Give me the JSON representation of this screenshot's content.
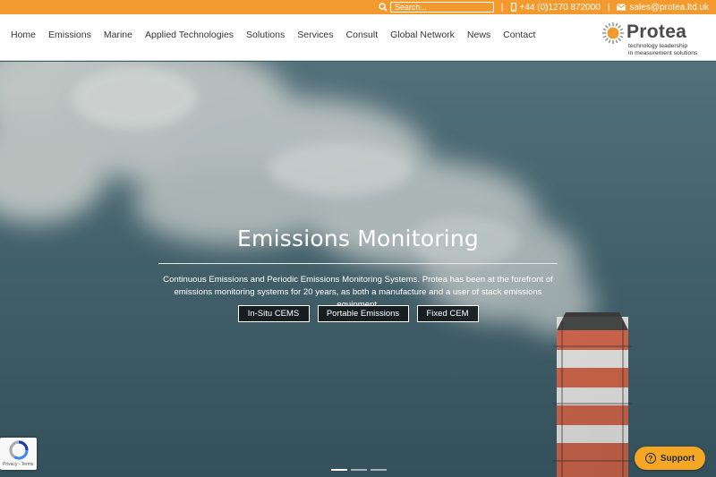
{
  "topbar": {
    "search_placeholder": "Search...",
    "separator": "|",
    "phone": "+44 (0)1270 872000",
    "email": "sales@protea.ltd.uk"
  },
  "nav": {
    "items": [
      "Home",
      "Emissions",
      "Marine",
      "Applied Technologies",
      "Solutions",
      "Services",
      "Consult",
      "Global Network",
      "News",
      "Contact"
    ]
  },
  "logo": {
    "name": "Protea",
    "tagline_1": "technology leadership",
    "tagline_2": "in measurement solutions"
  },
  "hero": {
    "title": "Emissions Monitoring",
    "description": "Continuous Emissions and Periodic Emissions Monitoring Systems. Protea has been at the forefront of emissions monitoring systems for 20 years, as both a manufacture and a user of stack emissions equipment.",
    "buttons": [
      "In-Situ CEMS",
      "Portable Emissions",
      "Fixed CEM"
    ]
  },
  "recaptcha": {
    "text": "Privacy - Terms"
  },
  "support": {
    "label": "Support",
    "icon_glyph": "?"
  },
  "colors": {
    "accent": "#f39a2e",
    "support": "#f5a623"
  }
}
